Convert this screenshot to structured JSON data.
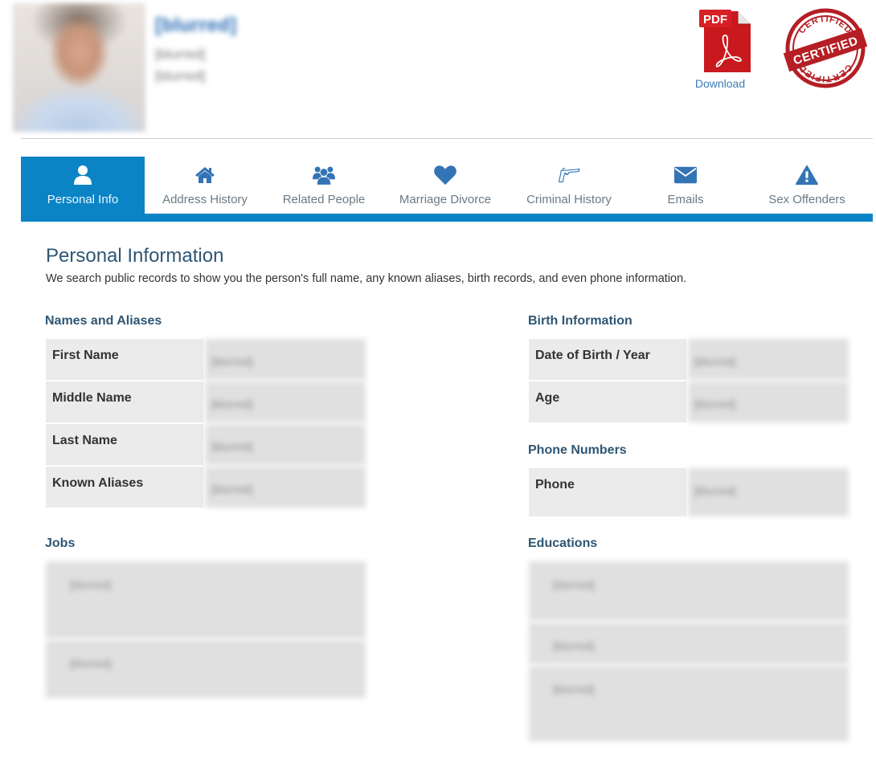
{
  "profile": {
    "name": "[blurred]",
    "address_line1": "[blurred]",
    "address_line2": "[blurred]",
    "photo": "blurred-person-photo"
  },
  "actions": {
    "pdf_badge": "PDF",
    "download_label": "Download",
    "certified_top": "CERTIFIED",
    "certified_center": "CERTIFIED",
    "certified_bottom": "CERTIFIED"
  },
  "tabs": [
    {
      "label": "Personal Info",
      "icon": "user-icon",
      "active": true
    },
    {
      "label": "Address History",
      "icon": "home-icon",
      "active": false
    },
    {
      "label": "Related People",
      "icon": "users-icon",
      "active": false
    },
    {
      "label": "Marriage Divorce",
      "icon": "heart-icon",
      "active": false
    },
    {
      "label": "Criminal History",
      "icon": "gun-icon",
      "active": false
    },
    {
      "label": "Emails",
      "icon": "envelope-icon",
      "active": false
    },
    {
      "label": "Sex Offenders",
      "icon": "warning-icon",
      "active": false
    }
  ],
  "colors": {
    "accent": "#0b84c6",
    "heading": "#2e5674",
    "icon": "#3374b5",
    "name": "#2a6db5"
  },
  "main": {
    "title": "Personal Information",
    "description": "We search public records to show you the person's full name, any known aliases, birth records, and even phone information."
  },
  "names_aliases": {
    "title": "Names and Aliases",
    "rows": [
      {
        "key": "First Name",
        "value": "[blurred]"
      },
      {
        "key": "Middle Name",
        "value": "[blurred]"
      },
      {
        "key": "Last Name",
        "value": "[blurred]"
      },
      {
        "key": "Known Aliases",
        "value": "[blurred]"
      }
    ]
  },
  "birth_info": {
    "title": "Birth Information",
    "rows": [
      {
        "key": "Date of Birth / Year",
        "value": "[blurred]"
      },
      {
        "key": "Age",
        "value": "[blurred]"
      }
    ]
  },
  "phone_numbers": {
    "title": "Phone Numbers",
    "rows": [
      {
        "key": "Phone",
        "value": "[blurred]"
      }
    ]
  },
  "jobs": {
    "title": "Jobs",
    "items": [
      "[blurred]",
      "[blurred]"
    ]
  },
  "educations": {
    "title": "Educations",
    "items": [
      "[blurred]",
      "[blurred]",
      "[blurred]"
    ]
  }
}
